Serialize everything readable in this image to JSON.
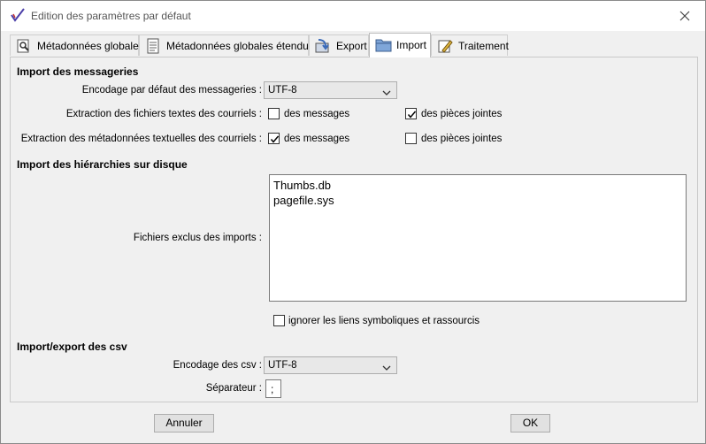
{
  "window": {
    "title": "Edition des paramètres par défaut"
  },
  "tabs": [
    {
      "label": "Métadonnées globales",
      "icon": "magnifier-doc-icon"
    },
    {
      "label": "Métadonnées globales étendues",
      "icon": "document-lines-icon"
    },
    {
      "label": "Export",
      "icon": "export-arrow-icon"
    },
    {
      "label": "Import",
      "icon": "folder-icon",
      "active": true
    },
    {
      "label": "Traitement",
      "icon": "pencil-doc-icon"
    }
  ],
  "messageries": {
    "heading": "Import des messageries",
    "encoding_label": "Encodage par défaut des messageries :",
    "encoding_value": "UTF-8",
    "text_extract_label": "Extraction des fichiers textes des courriels :",
    "text_messages_label": "des messages",
    "text_messages_checked": false,
    "text_attachments_label": "des pièces jointes",
    "text_attachments_checked": true,
    "meta_extract_label": "Extraction des métadonnées textuelles des courriels :",
    "meta_messages_label": "des messages",
    "meta_messages_checked": true,
    "meta_attachments_label": "des pièces jointes",
    "meta_attachments_checked": false
  },
  "hierarchies": {
    "heading": "Import des hiérarchies sur disque",
    "excluded_label": "Fichiers exclus des imports :",
    "excluded_files": [
      "Thumbs.db",
      "pagefile.sys"
    ],
    "ignore_links_label": "ignorer les liens symboliques et rassourcis",
    "ignore_links_checked": false
  },
  "csv": {
    "heading": "Import/export des csv",
    "encoding_label": "Encodage des csv :",
    "encoding_value": "UTF-8",
    "separator_label": "Séparateur :",
    "separator_value": ";"
  },
  "footer": {
    "cancel_label": "Annuler",
    "ok_label": "OK"
  },
  "colors": {
    "check": "#000000",
    "checkmark_accent": "#4b3fa8"
  }
}
